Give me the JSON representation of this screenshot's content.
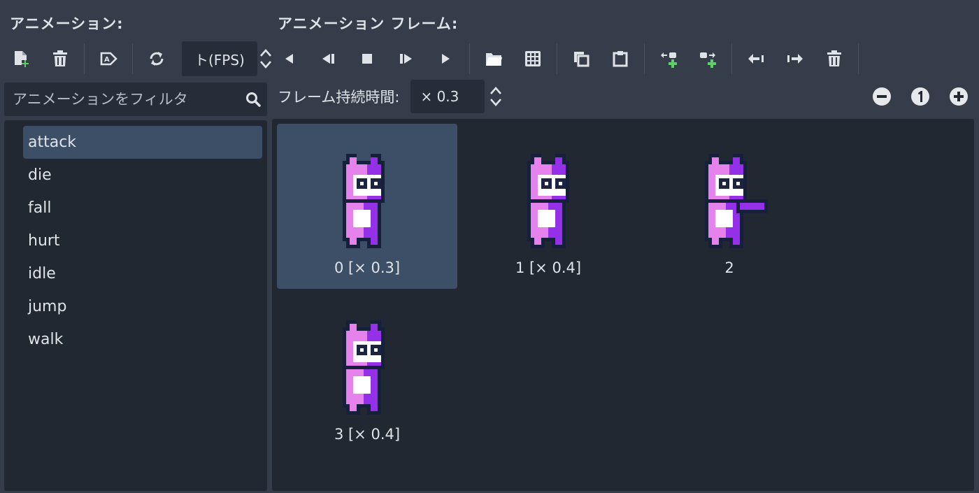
{
  "animations_panel": {
    "title": "アニメーション:",
    "fps_value": "ト(FPS)",
    "filter_placeholder": "アニメーションをフィルタ",
    "items": [
      {
        "label": "attack",
        "selected": true
      },
      {
        "label": "die",
        "selected": false
      },
      {
        "label": "fall",
        "selected": false
      },
      {
        "label": "hurt",
        "selected": false
      },
      {
        "label": "idle",
        "selected": false
      },
      {
        "label": "jump",
        "selected": false
      },
      {
        "label": "walk",
        "selected": false
      }
    ]
  },
  "frames_panel": {
    "title": "アニメーション フレーム:",
    "duration_label": "フレーム持続時間:",
    "duration_value": "× 0.3",
    "frames": [
      {
        "label": "0 [× 0.3]",
        "selected": true
      },
      {
        "label": "1 [× 0.4]",
        "selected": false
      },
      {
        "label": "2",
        "selected": false
      },
      {
        "label": "3 [× 0.4]",
        "selected": false
      }
    ]
  },
  "icons": {
    "left_toolbar": [
      "new-animation-icon",
      "delete-animation-icon",
      "autoplay-icon",
      "loop-icon"
    ],
    "frame_toolbar": [
      "play-backwards-icon",
      "step-backwards-icon",
      "stop-icon",
      "step-forward-icon",
      "play-icon",
      "load-frames-icon",
      "spritesheet-icon",
      "copy-icon",
      "paste-icon",
      "insert-before-icon",
      "insert-after-icon",
      "move-left-icon",
      "move-right-icon",
      "delete-frame-icon"
    ],
    "zoom": [
      "zoom-out-icon",
      "zoom-reset-icon",
      "zoom-in-icon"
    ]
  },
  "colors": {
    "background": "#363d4a",
    "panel": "#222832",
    "field": "#272d38",
    "selection": "#3c4f66",
    "text": "#e0e3e8",
    "add_green": "#5fd068"
  }
}
